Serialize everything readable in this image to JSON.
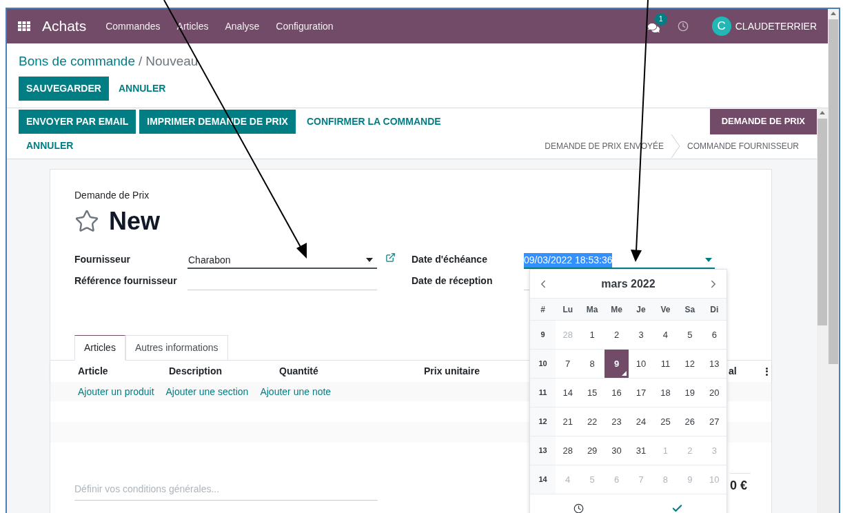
{
  "navbar": {
    "app": "Achats",
    "menus": [
      "Commandes",
      "Articles",
      "Analyse",
      "Configuration"
    ],
    "messages_badge": "1",
    "user_initial": "C",
    "user": "CLAUDETERRIER"
  },
  "breadcrumb": {
    "parent": "Bons de commande",
    "separator": "/",
    "current": "Nouveau"
  },
  "actions": [
    {
      "label": "SAUVEGARDER",
      "kind": "primary"
    },
    {
      "label": "ANNULER",
      "kind": "link"
    }
  ],
  "statusbar": {
    "buttons": [
      {
        "label": "ENVOYER PAR EMAIL",
        "kind": "primary"
      },
      {
        "label": "IMPRIMER DEMANDE DE PRIX",
        "kind": "primary"
      },
      {
        "label": "CONFIRMER LA COMMANDE",
        "kind": "link"
      },
      {
        "label": "ANNULER",
        "kind": "link"
      }
    ],
    "statuses": [
      {
        "label": "DEMANDE DE PRIX",
        "selected": true
      },
      {
        "label": "DEMANDE DE PRIX ENVOYÉE",
        "selected": false
      },
      {
        "label": "COMMANDE FOURNISSEUR",
        "selected": false
      }
    ]
  },
  "sheet": {
    "subtitle": "Demande de Prix",
    "title": "New",
    "left_fields": [
      {
        "label": "Fournisseur",
        "value": "Charabon",
        "kind": "many2one"
      },
      {
        "label": "Référence fournisseur",
        "kind": "text"
      }
    ],
    "right_fields": [
      {
        "label": "Date d'échéance",
        "value": "09/03/2022 18:53:36",
        "kind": "date"
      },
      {
        "label": "Date de réception",
        "kind": "text"
      }
    ],
    "tabs": [
      {
        "label": "Articles",
        "selected": true
      },
      {
        "label": "Autres informations",
        "selected": false
      }
    ],
    "columns": [
      "Article",
      "Description",
      "Quantité",
      "Prix unitaire",
      "al"
    ],
    "add_links": [
      "Ajouter un produit",
      "Ajouter une section",
      "Ajouter une note"
    ],
    "terms": {
      "placeholder": "Définir vos conditions générales..."
    },
    "total": "0 €"
  },
  "datepicker": {
    "month": "mars 2022",
    "weekdays": [
      "#",
      "Lu",
      "Ma",
      "Me",
      "Je",
      "Ve",
      "Sa",
      "Di"
    ],
    "weeks": [
      {
        "number": "9",
        "days": [
          {
            "label": "28",
            "muted": true,
            "selected": false
          },
          {
            "label": "1",
            "muted": false,
            "selected": false
          },
          {
            "label": "2",
            "muted": false,
            "selected": false
          },
          {
            "label": "3",
            "muted": false,
            "selected": false
          },
          {
            "label": "4",
            "muted": false,
            "selected": false
          },
          {
            "label": "5",
            "muted": false,
            "selected": false
          },
          {
            "label": "6",
            "muted": false,
            "selected": false
          }
        ]
      },
      {
        "number": "10",
        "days": [
          {
            "label": "7",
            "muted": false,
            "selected": false
          },
          {
            "label": "8",
            "muted": false,
            "selected": false
          },
          {
            "label": "9",
            "muted": false,
            "selected": true
          },
          {
            "label": "10",
            "muted": false,
            "selected": false
          },
          {
            "label": "11",
            "muted": false,
            "selected": false
          },
          {
            "label": "12",
            "muted": false,
            "selected": false
          },
          {
            "label": "13",
            "muted": false,
            "selected": false
          }
        ]
      },
      {
        "number": "11",
        "days": [
          {
            "label": "14",
            "muted": false,
            "selected": false
          },
          {
            "label": "15",
            "muted": false,
            "selected": false
          },
          {
            "label": "16",
            "muted": false,
            "selected": false
          },
          {
            "label": "17",
            "muted": false,
            "selected": false
          },
          {
            "label": "18",
            "muted": false,
            "selected": false
          },
          {
            "label": "19",
            "muted": false,
            "selected": false
          },
          {
            "label": "20",
            "muted": false,
            "selected": false
          }
        ]
      },
      {
        "number": "12",
        "days": [
          {
            "label": "21",
            "muted": false,
            "selected": false
          },
          {
            "label": "22",
            "muted": false,
            "selected": false
          },
          {
            "label": "23",
            "muted": false,
            "selected": false
          },
          {
            "label": "24",
            "muted": false,
            "selected": false
          },
          {
            "label": "25",
            "muted": false,
            "selected": false
          },
          {
            "label": "26",
            "muted": false,
            "selected": false
          },
          {
            "label": "27",
            "muted": false,
            "selected": false
          }
        ]
      },
      {
        "number": "13",
        "days": [
          {
            "label": "28",
            "muted": false,
            "selected": false
          },
          {
            "label": "29",
            "muted": false,
            "selected": false
          },
          {
            "label": "30",
            "muted": false,
            "selected": false
          },
          {
            "label": "31",
            "muted": false,
            "selected": false
          },
          {
            "label": "1",
            "muted": true,
            "selected": false
          },
          {
            "label": "2",
            "muted": true,
            "selected": false
          },
          {
            "label": "3",
            "muted": true,
            "selected": false
          }
        ]
      },
      {
        "number": "14",
        "days": [
          {
            "label": "4",
            "muted": true,
            "selected": false
          },
          {
            "label": "5",
            "muted": true,
            "selected": false
          },
          {
            "label": "6",
            "muted": true,
            "selected": false
          },
          {
            "label": "7",
            "muted": true,
            "selected": false
          },
          {
            "label": "8",
            "muted": true,
            "selected": false
          },
          {
            "label": "9",
            "muted": true,
            "selected": false
          },
          {
            "label": "10",
            "muted": true,
            "selected": false
          }
        ]
      }
    ]
  }
}
